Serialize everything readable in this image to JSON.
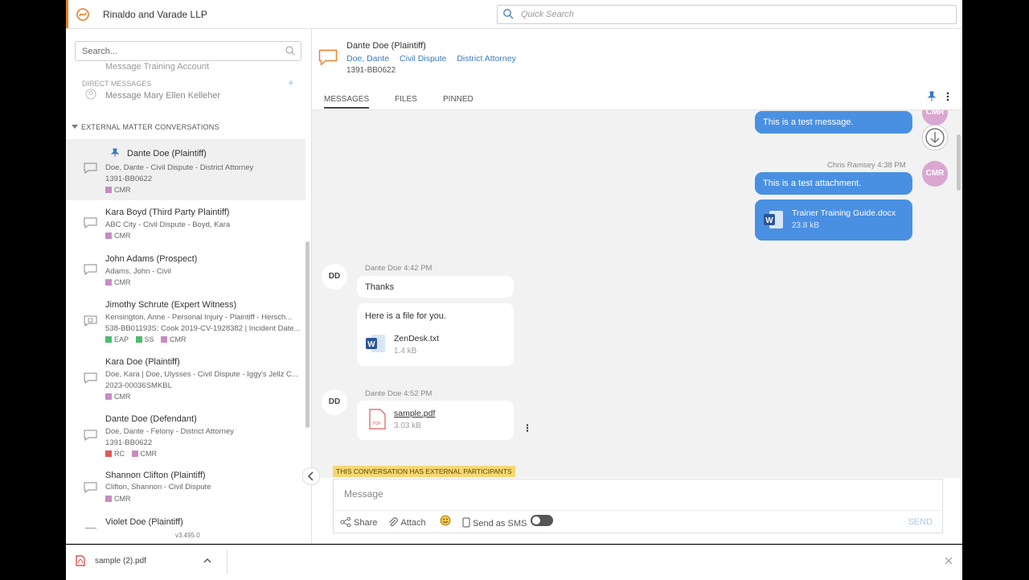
{
  "app": {
    "firm_name": "Rinaldo and Varade LLP",
    "quick_search_placeholder": "Quick Search"
  },
  "sidebar": {
    "search_placeholder": "Search...",
    "faded_item": "Message Training Account",
    "direct_messages_label": "DIRECT MESSAGES",
    "direct_message_item": "Message Mary Ellen Kelleher",
    "section_label": "EXTERNAL MATTER CONVERSATIONS",
    "version": "v3.495.0",
    "conversations": [
      {
        "title": "Dante Doe (Plaintiff)",
        "sub1": "Doe, Dante - Civil Dispute - District Attorney",
        "sub2": "1391-BB0622",
        "tags": [
          {
            "label": "CMR",
            "color": "#c98bc2"
          }
        ]
      },
      {
        "title": "Kara Boyd (Third Party Plaintiff)",
        "sub1": "ABC City - Civil Dispute - Boyd, Kara",
        "tags": [
          {
            "label": "CMR",
            "color": "#c98bc2"
          }
        ]
      },
      {
        "title": "John Adams (Prospect)",
        "sub1": "Adams, John - Civil",
        "tags": [
          {
            "label": "CMR",
            "color": "#c98bc2"
          }
        ]
      },
      {
        "title": "Jimothy Schrute (Expert Witness)",
        "sub1": "Kensington, Anne - Personal Injury - Plaintiff - Hersch...",
        "sub2": "538-BB01193S: Cook 2019-CV-1928382 | Incident Date...",
        "tags": [
          {
            "label": "EAP",
            "color": "#4cbb6b"
          },
          {
            "label": "SS",
            "color": "#4cbb6b"
          },
          {
            "label": "CMR",
            "color": "#c98bc2"
          }
        ]
      },
      {
        "title": "Kara Doe (Plaintiff)",
        "sub1": "Doe, Kara | Doe, Ulysses - Civil Dispute - Iggy's Jellz C...",
        "sub2": "2023-00036SMKBL",
        "tags": [
          {
            "label": "CMR",
            "color": "#c98bc2"
          }
        ]
      },
      {
        "title": "Dante Doe (Defendant)",
        "sub1": "Doe, Dante - Felony - District Attorney",
        "sub2": "1391-BB0622",
        "tags": [
          {
            "label": "RC",
            "color": "#e05a5a"
          },
          {
            "label": "CMR",
            "color": "#c98bc2"
          }
        ]
      },
      {
        "title": "Shannon Clifton (Plaintiff)",
        "sub1": "Clifton, Shannon - Civil Dispute",
        "tags": [
          {
            "label": "CMR",
            "color": "#c98bc2"
          }
        ]
      },
      {
        "title": "Violet Doe (Plaintiff)"
      }
    ]
  },
  "conversation": {
    "title": "Dante Doe (Plaintiff)",
    "links": [
      "Doe, Dante",
      "Civil Dispute",
      "District Attorney"
    ],
    "number": "1391-BB0622",
    "tabs": [
      "MESSAGES",
      "FILES",
      "PINNED"
    ]
  },
  "messages": {
    "out1": "This is a test message.",
    "out_sender": "Chris Ramsey",
    "out_time": "4:38 PM",
    "out2": "This is a test attachment.",
    "out_file": {
      "name": "Trainer Training Guide.docx",
      "size": "23.8 kB"
    },
    "in_sender": "Dante Doe",
    "in_time1": "4:42 PM",
    "in1": "Thanks",
    "in2": "Here is a file for you.",
    "in_file": {
      "name": "ZenDesk.txt",
      "size": "1.4 kB"
    },
    "in_time2": "4:52 PM",
    "in_file2": {
      "name": "sample.pdf",
      "size": "3.03 kB"
    },
    "avatar_cmr": "CMR",
    "avatar_dd": "DD"
  },
  "composer": {
    "external_banner": "THIS CONVERSATION HAS EXTERNAL PARTICIPANTS",
    "placeholder": "Message",
    "share": "Share",
    "attach": "Attach",
    "sms": "Send as SMS",
    "send": "SEND"
  },
  "downloads": {
    "file": "sample (2).pdf"
  }
}
